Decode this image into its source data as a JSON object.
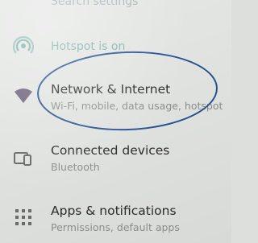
{
  "settings": {
    "top_partial_text": "Search settings",
    "hotspot_status": "Hotspot is on",
    "items": [
      {
        "title": "Network & Internet",
        "subtitle": "Wi-Fi, mobile, data usage, hotspot",
        "icon": "wifi-icon"
      },
      {
        "title": "Connected devices",
        "subtitle": "Bluetooth",
        "icon": "connected-devices-icon"
      },
      {
        "title": "Apps & notifications",
        "subtitle": "Permissions, default apps",
        "icon": "apps-grid-icon"
      }
    ]
  },
  "colors": {
    "annotation_oval": "#254f8e",
    "hotspot_accent": "#7fb3ac",
    "text_primary": "#2b2b2b",
    "text_secondary": "#8a8e8a"
  }
}
